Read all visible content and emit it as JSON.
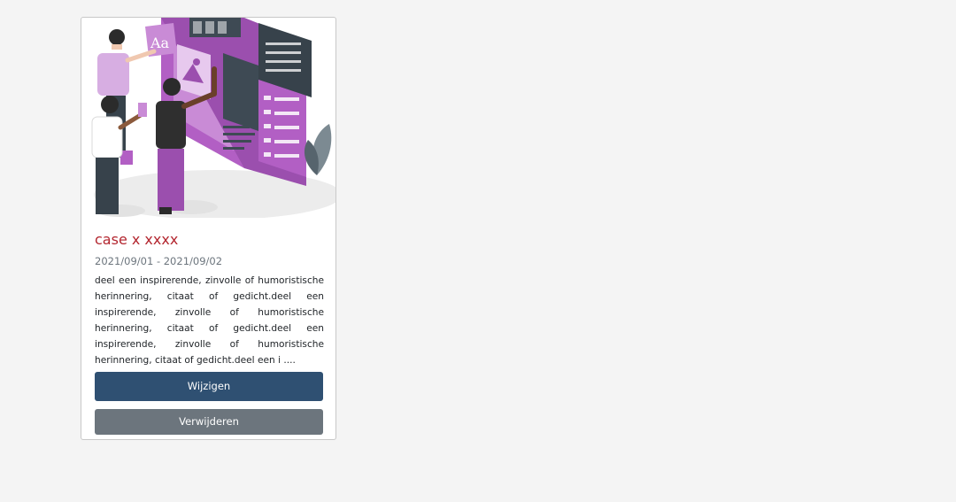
{
  "card": {
    "title": "case x xxxx",
    "dates": "2021/09/01 - 2021/09/02",
    "description": "deel een inspirerende, zinvolle of humoristische herinnering, citaat of gedicht.deel een inspirerende, zinvolle of humoristische herinnering, citaat of gedicht.deel een inspirerende, zinvolle of humoristische herinnering, citaat of gedicht.deel een i ....",
    "image_icon": "people-editing-web-page-illustration",
    "edit_button_label": "Wijzigen",
    "delete_button_label": "Verwijderen"
  },
  "colors": {
    "page_background": "#f4f4f4",
    "title": "#b3262f",
    "primary_button": "#2f5072",
    "secondary_button": "#6c757d",
    "illustration_accent": "#9b4fae"
  }
}
